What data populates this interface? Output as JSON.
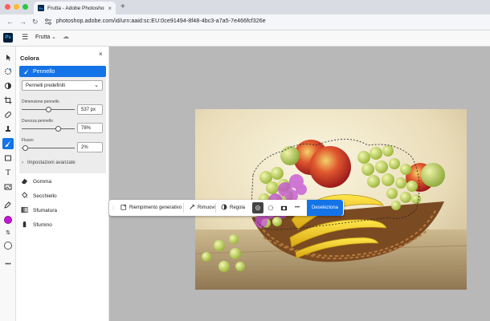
{
  "browser": {
    "tab_title": "Frutta - Adobe Photoshop",
    "tab_close": "×",
    "new_tab": "+",
    "url": "photoshop.adobe.com/id/urn:aaid:sc:EU:0ce91494-8f48-4bc3-a7a5-7e466fcf326e",
    "nav": {
      "back": "←",
      "forward": "→",
      "reload": "↻"
    }
  },
  "app": {
    "logo": "Ps",
    "document_name": "Frutta",
    "icons": {
      "menu": "menu-icon",
      "cloud": "cloud-icon"
    }
  },
  "colors": {
    "accent": "#1473e6",
    "foreground_swatch": "#c516d6",
    "background_swatch": "#ffffff",
    "traffic_red": "#ff5f57",
    "traffic_yellow": "#febc2e",
    "traffic_green": "#28c840"
  },
  "panel": {
    "title": "Colora",
    "close": "×",
    "active_tool": "Pennello",
    "preset": "Pennelli predefiniti",
    "sliders": [
      {
        "label": "Dimensione pennello",
        "value": "537 px",
        "level": 0.5
      },
      {
        "label": "Durezza pennello",
        "value": "78%",
        "level": 0.78
      },
      {
        "label": "Flusso",
        "value": "2%",
        "level": 0.02
      }
    ],
    "advanced": "Impostazioni avanzate",
    "items": [
      {
        "label": "Gomma",
        "icon": "eraser-icon"
      },
      {
        "label": "Secchiello",
        "icon": "bucket-icon"
      },
      {
        "label": "Sfumatura",
        "icon": "gradient-icon"
      },
      {
        "label": "Sfumino",
        "icon": "smudge-icon"
      }
    ]
  },
  "taskbar": {
    "generative_fill": "Riempimento generativo",
    "remove": "Rimuovi",
    "adjust": "Regola",
    "more": "•••",
    "deselect": "Deseleziona"
  }
}
